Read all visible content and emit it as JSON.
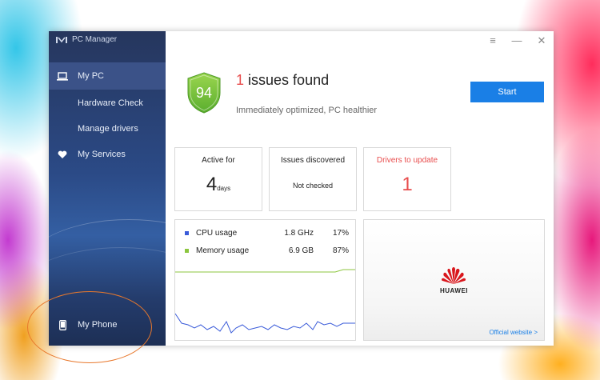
{
  "app": {
    "title": "PC Manager"
  },
  "sidebar": {
    "items": [
      {
        "label": "My PC",
        "icon": "laptop-icon"
      },
      {
        "label": "Hardware Check"
      },
      {
        "label": "Manage drivers"
      },
      {
        "label": "My Services",
        "icon": "heart-icon"
      },
      {
        "label": "My Phone",
        "icon": "phone-icon"
      }
    ]
  },
  "window_controls": {
    "menu": "≡",
    "minimize": "—",
    "close": "✕"
  },
  "status": {
    "score": "94",
    "issue_count": "1",
    "issues_text": "issues found",
    "subtitle": "Immediately optimized, PC healthier",
    "start_label": "Start"
  },
  "cards": {
    "active": {
      "title": "Active for",
      "value": "4",
      "unit": "days"
    },
    "issues": {
      "title": "Issues discovered",
      "value": "Not checked"
    },
    "drivers": {
      "title": "Drivers to update",
      "value": "1"
    }
  },
  "stats": {
    "cpu": {
      "label": "CPU usage",
      "value": "1.8 GHz",
      "percent": "17%",
      "color": "#3a5bd9"
    },
    "memory": {
      "label": "Memory usage",
      "value": "6.9 GB",
      "percent": "87%",
      "color": "#8cc63f"
    }
  },
  "promo": {
    "brand": "HUAWEI",
    "link": "Official website >"
  },
  "colors": {
    "accent": "#1a7fe6",
    "alert": "#e84d4d",
    "shield": "#7cc444"
  }
}
